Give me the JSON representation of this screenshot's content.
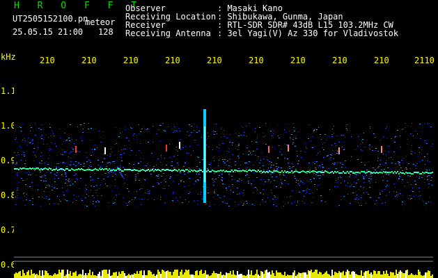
{
  "header": {
    "title": "H R O F F T",
    "filename": "UT2505152100.pn",
    "mode": "meteor",
    "datetime": "25.05.15 21:00",
    "count": "128"
  },
  "info": {
    "rows": [
      {
        "label": "Observer",
        "value": ": Masaki Kano"
      },
      {
        "label": "Receiving Location",
        "value": ": Shibukawa, Gunma, Japan"
      },
      {
        "label": "Receiver",
        "value": ": RTL-SDR SDR# 43dB L15 103.2MHz CW"
      },
      {
        "label": "Receiving Antenna",
        "value": ": 3el Yagi(V) Az 330 for Vladivostok"
      }
    ]
  },
  "axes": {
    "y_unit": "kHz",
    "x_ticks": [
      "210",
      "210",
      "210",
      "210",
      "210",
      "210",
      "210",
      "210",
      "210",
      "2110"
    ],
    "y_ticks": [
      "1.1",
      "1.0",
      "0.9",
      "0.8",
      "0.7",
      "0.6"
    ]
  },
  "colors": {
    "background": "#000000",
    "text_main": "#ffffff",
    "title": "#00e000",
    "axis": "#ffff00",
    "noise": "#1a2cff",
    "trace": "#00ff80"
  }
}
